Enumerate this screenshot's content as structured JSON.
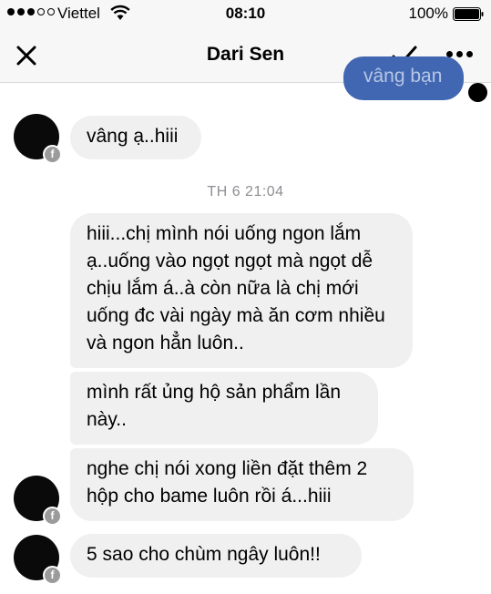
{
  "status_bar": {
    "carrier": "Viettel",
    "time": "08:10",
    "battery": "100%"
  },
  "nav": {
    "title": "Dari Sen",
    "close_icon": "close-icon",
    "check_icon": "check-icon",
    "more_icon": "more-icon"
  },
  "thread": {
    "outgoing_partial": "vâng bạn",
    "timestamp": "TH 6 21:04",
    "messages": [
      {
        "text": "vâng ạ..hiii"
      },
      {
        "text": "hiii...chị mình nói uống ngon lắm ạ..uống vào ngọt ngọt mà ngọt dễ chịu lắm á..à còn nữa là chị mới uống đc vài ngày mà ăn cơm nhiều và ngon hẳn luôn.."
      },
      {
        "text": "mình rất ủng hộ sản phẩm lần này.."
      },
      {
        "text": "nghe chị nói xong liền đặt thêm 2 hộp cho bame luôn rồi á...hiii"
      },
      {
        "text": "5 sao cho chùm ngây luôn!!"
      }
    ],
    "avatar_badge": "f"
  },
  "colors": {
    "outgoing": "#4267b2",
    "incoming": "#f0f0f0",
    "timestamp": "#8e8e93"
  }
}
